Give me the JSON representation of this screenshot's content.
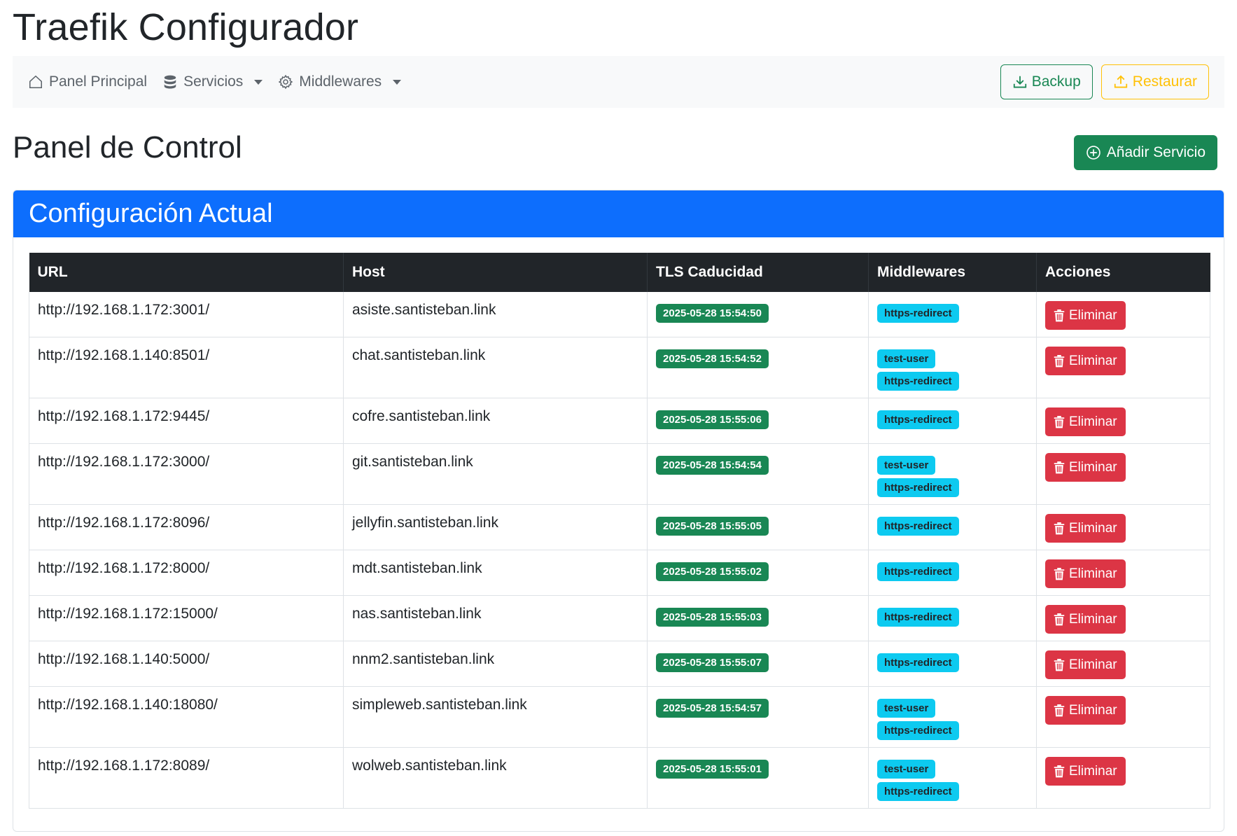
{
  "app": {
    "title": "Traefik Configurador"
  },
  "nav": {
    "items": [
      {
        "label": "Panel Principal",
        "icon": "house-icon"
      },
      {
        "label": "Servicios",
        "icon": "database-icon",
        "dropdown": true
      },
      {
        "label": "Middlewares",
        "icon": "gear-icon",
        "dropdown": true
      }
    ],
    "backup_label": "Backup",
    "restore_label": "Restaurar"
  },
  "page": {
    "title": "Panel de Control",
    "add_service_label": "Añadir Servicio"
  },
  "card": {
    "title": "Configuración Actual"
  },
  "table": {
    "headers": [
      "URL",
      "Host",
      "TLS Caducidad",
      "Middlewares",
      "Acciones"
    ],
    "delete_label": "Eliminar",
    "rows": [
      {
        "url": "http://192.168.1.172:3001/",
        "host": "asiste.santisteban.link",
        "tls": "2025-05-28 15:54:50",
        "middlewares": [
          "https-redirect"
        ]
      },
      {
        "url": "http://192.168.1.140:8501/",
        "host": "chat.santisteban.link",
        "tls": "2025-05-28 15:54:52",
        "middlewares": [
          "test-user",
          "https-redirect"
        ]
      },
      {
        "url": "http://192.168.1.172:9445/",
        "host": "cofre.santisteban.link",
        "tls": "2025-05-28 15:55:06",
        "middlewares": [
          "https-redirect"
        ]
      },
      {
        "url": "http://192.168.1.172:3000/",
        "host": "git.santisteban.link",
        "tls": "2025-05-28 15:54:54",
        "middlewares": [
          "test-user",
          "https-redirect"
        ]
      },
      {
        "url": "http://192.168.1.172:8096/",
        "host": "jellyfin.santisteban.link",
        "tls": "2025-05-28 15:55:05",
        "middlewares": [
          "https-redirect"
        ]
      },
      {
        "url": "http://192.168.1.172:8000/",
        "host": "mdt.santisteban.link",
        "tls": "2025-05-28 15:55:02",
        "middlewares": [
          "https-redirect"
        ]
      },
      {
        "url": "http://192.168.1.172:15000/",
        "host": "nas.santisteban.link",
        "tls": "2025-05-28 15:55:03",
        "middlewares": [
          "https-redirect"
        ]
      },
      {
        "url": "http://192.168.1.140:5000/",
        "host": "nnm2.santisteban.link",
        "tls": "2025-05-28 15:55:07",
        "middlewares": [
          "https-redirect"
        ]
      },
      {
        "url": "http://192.168.1.140:18080/",
        "host": "simpleweb.santisteban.link",
        "tls": "2025-05-28 15:54:57",
        "middlewares": [
          "test-user",
          "https-redirect"
        ]
      },
      {
        "url": "http://192.168.1.172:8089/",
        "host": "wolweb.santisteban.link",
        "tls": "2025-05-28 15:55:01",
        "middlewares": [
          "test-user",
          "https-redirect"
        ]
      }
    ]
  },
  "colors": {
    "primary": "#0d6efd",
    "success": "#198754",
    "warning": "#ffc107",
    "danger": "#dc3545",
    "info": "#0dcaf0",
    "dark": "#212529"
  }
}
